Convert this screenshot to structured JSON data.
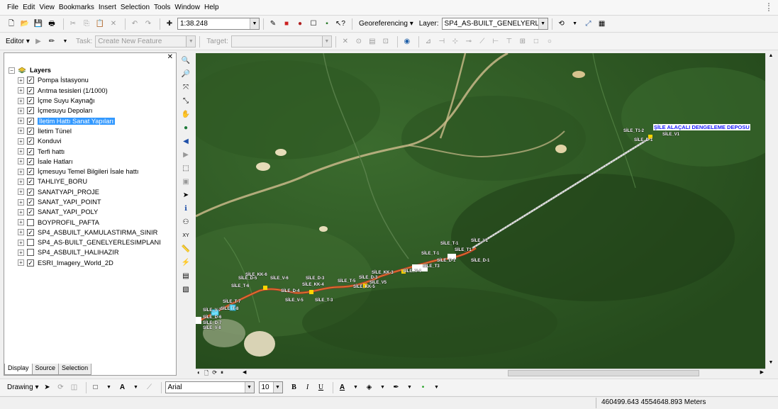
{
  "menu": [
    "File",
    "Edit",
    "View",
    "Bookmarks",
    "Insert",
    "Selection",
    "Tools",
    "Window",
    "Help"
  ],
  "toolbar1": {
    "scale": "1:38.248",
    "georeferencing_label": "Georeferencing",
    "layer_label": "Layer:",
    "layer_value": "SP4_AS-BUILT_GENELYERLESIM"
  },
  "toolbar2": {
    "editor_label": "Editor",
    "task_label": "Task:",
    "task_value": "Create New Feature",
    "target_label": "Target:",
    "target_value": ""
  },
  "toc": {
    "root_label": "Layers",
    "layers": [
      {
        "name": "Pompa İstasyonu",
        "checked": true
      },
      {
        "name": "Arıtma tesisleri (1/1000)",
        "checked": true
      },
      {
        "name": "İçme Suyu Kaynağı",
        "checked": true
      },
      {
        "name": "İçmesuyu Depoları",
        "checked": true
      },
      {
        "name": "İletim Hattı Sanat Yapıları",
        "checked": true
      },
      {
        "name": "İletim Tünel",
        "checked": true
      },
      {
        "name": "Konduvi",
        "checked": true
      },
      {
        "name": "Terfi hattı",
        "checked": true
      },
      {
        "name": "İsale Hatları",
        "checked": true
      },
      {
        "name": "İçmesuyu Temel Bilgileri İsale hattı",
        "checked": true
      },
      {
        "name": "TAHLIYE_BORU",
        "checked": true
      },
      {
        "name": "SANATYAPI_PROJE",
        "checked": true
      },
      {
        "name": "SANAT_YAPI_POINT",
        "checked": true
      },
      {
        "name": "SANAT_YAPI_POLY",
        "checked": true
      },
      {
        "name": "BOYPROFIL_PAFTA",
        "checked": false
      },
      {
        "name": "SP4_ASBUILT_KAMULASTIRMA_SINIR",
        "checked": true
      },
      {
        "name": "SP4_AS-BUILT_GENELYERLESIMPLANI",
        "checked": false
      },
      {
        "name": "SP4_ASBUILT_HALIHAZIR",
        "checked": false
      },
      {
        "name": "ESRI_Imagery_World_2D",
        "checked": true
      }
    ],
    "tabs": [
      "Display",
      "Source",
      "Selection"
    ]
  },
  "map": {
    "depot_label": "ŞİLE ALAÇALI DENGELEME DEPOSU",
    "labels": [
      {
        "text": "SİLE_T1-2"
      },
      {
        "text": "SİLE_V1"
      },
      {
        "text": "SİLE_D-1"
      },
      {
        "text": "SİLE_V1"
      },
      {
        "text": "SİLE_T-1"
      },
      {
        "text": "SİLE_T1"
      },
      {
        "text": "SİLE_D-1"
      },
      {
        "text": "SİLE_T-1"
      },
      {
        "text": "SİLE_D-1"
      },
      {
        "text": "SİLE_T3"
      },
      {
        "text": "SİLE_V-4"
      },
      {
        "text": "SİLE_KK-3"
      },
      {
        "text": "SİLE_D-3"
      },
      {
        "text": "SİLE_T-5"
      },
      {
        "text": "SİLE_V5"
      },
      {
        "text": "SİLE_KK-5"
      },
      {
        "text": "SİLE_D-3"
      },
      {
        "text": "SİLE_D-4"
      },
      {
        "text": "SİLE_KK-4"
      },
      {
        "text": "SİLE_T-3"
      },
      {
        "text": "SİLE_V-5"
      },
      {
        "text": "SİLE_KK-6"
      },
      {
        "text": "SİLE_V-6"
      },
      {
        "text": "SİLE_T-6"
      },
      {
        "text": "SİLE_D-5"
      },
      {
        "text": "SİLE_T-7"
      },
      {
        "text": "SİLE_V-7"
      },
      {
        "text": "SİLE_D-6"
      },
      {
        "text": "SİLE_T-8"
      },
      {
        "text": "SİLE_D-7"
      },
      {
        "text": "SİLE_V-8"
      }
    ]
  },
  "drawing": {
    "drawing_label": "Drawing",
    "font_name": "Arial",
    "font_size": "10",
    "bold": "B",
    "italic": "I",
    "underline": "U"
  },
  "status": {
    "coordinates": "460499.643  4554648.893 Meters"
  }
}
